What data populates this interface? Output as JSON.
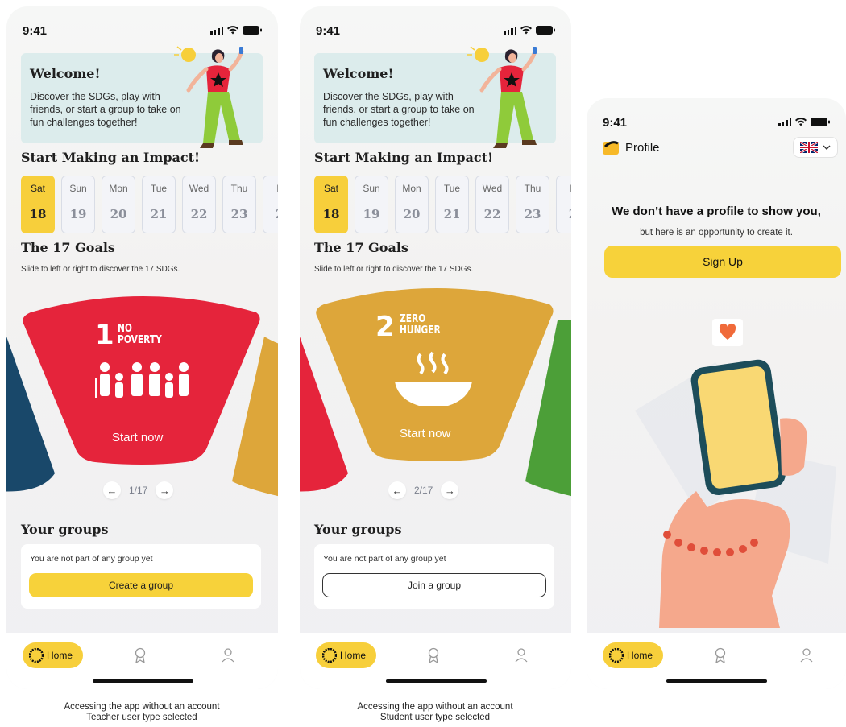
{
  "status_time": "9:41",
  "phones": [
    {
      "welcome_title": "Welcome!",
      "welcome_text": "Discover the SDGs, play with friends, or start a group to take on fun challenges together!",
      "impact_title": "Start Making an Impact!",
      "days": [
        {
          "name": "Sat",
          "date": "18",
          "active": true
        },
        {
          "name": "Sun",
          "date": "19"
        },
        {
          "name": "Mon",
          "date": "20"
        },
        {
          "name": "Tue",
          "date": "21"
        },
        {
          "name": "Wed",
          "date": "22"
        },
        {
          "name": "Thu",
          "date": "23"
        },
        {
          "name": "F",
          "date": "2"
        }
      ],
      "goals_title": "The 17 Goals",
      "goals_subtitle": "Slide to left or right to discover the 17 SDGs.",
      "goal": {
        "number": "1",
        "name_line1": "NO",
        "name_line2": "POVERTY",
        "color": "#e5243b",
        "cta": "Start now"
      },
      "pager": "1/17",
      "groups_title": "Your groups",
      "groups_message": "You are not part of any group yet",
      "group_button": "Create a group",
      "nav": {
        "home": "Home"
      },
      "caption_line1": "Accessing the app without an account",
      "caption_line2": "Teacher user type selected"
    },
    {
      "welcome_title": "Welcome!",
      "welcome_text": "Discover the SDGs, play with friends, or start a group to take on fun challenges together!",
      "impact_title": "Start Making an Impact!",
      "days": [
        {
          "name": "Sat",
          "date": "18",
          "active": true
        },
        {
          "name": "Sun",
          "date": "19"
        },
        {
          "name": "Mon",
          "date": "20"
        },
        {
          "name": "Tue",
          "date": "21"
        },
        {
          "name": "Wed",
          "date": "22"
        },
        {
          "name": "Thu",
          "date": "23"
        },
        {
          "name": "F",
          "date": "2"
        }
      ],
      "goals_title": "The 17 Goals",
      "goals_subtitle": "Slide to left or right to discover the 17 SDGs.",
      "goal": {
        "number": "2",
        "name_line1": "ZERO",
        "name_line2": "HUNGER",
        "color": "#dda63a",
        "cta": "Start now"
      },
      "pager": "2/17",
      "groups_title": "Your groups",
      "groups_message": "You are not part of any group yet",
      "group_button": "Join a group",
      "nav": {
        "home": "Home"
      },
      "caption_line1": "Accessing the app without an account",
      "caption_line2": "Student user type selected"
    }
  ],
  "profile": {
    "title": "Profile",
    "empty_title": "We don’t have a profile to show you,",
    "empty_subtitle": "but here is an opportunity to create it.",
    "signup": "Sign Up",
    "nav": {
      "home": "Home"
    }
  },
  "colors": {
    "accent": "#f7cf3b",
    "goal1": "#e5243b",
    "goal2": "#dda63a",
    "goal3": "#4c9f38",
    "goal17": "#19486a"
  }
}
